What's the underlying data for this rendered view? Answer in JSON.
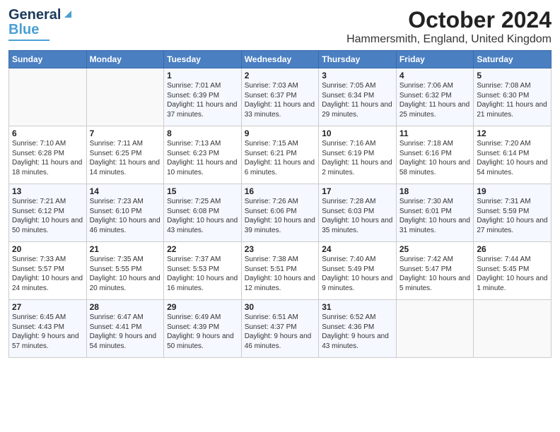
{
  "logo": {
    "line1": "General",
    "line2": "Blue"
  },
  "title": "October 2024",
  "subtitle": "Hammersmith, England, United Kingdom",
  "days_of_week": [
    "Sunday",
    "Monday",
    "Tuesday",
    "Wednesday",
    "Thursday",
    "Friday",
    "Saturday"
  ],
  "weeks": [
    [
      {
        "day": "",
        "sunrise": "",
        "sunset": "",
        "daylight": ""
      },
      {
        "day": "",
        "sunrise": "",
        "sunset": "",
        "daylight": ""
      },
      {
        "day": "1",
        "sunrise": "Sunrise: 7:01 AM",
        "sunset": "Sunset: 6:39 PM",
        "daylight": "Daylight: 11 hours and 37 minutes."
      },
      {
        "day": "2",
        "sunrise": "Sunrise: 7:03 AM",
        "sunset": "Sunset: 6:37 PM",
        "daylight": "Daylight: 11 hours and 33 minutes."
      },
      {
        "day": "3",
        "sunrise": "Sunrise: 7:05 AM",
        "sunset": "Sunset: 6:34 PM",
        "daylight": "Daylight: 11 hours and 29 minutes."
      },
      {
        "day": "4",
        "sunrise": "Sunrise: 7:06 AM",
        "sunset": "Sunset: 6:32 PM",
        "daylight": "Daylight: 11 hours and 25 minutes."
      },
      {
        "day": "5",
        "sunrise": "Sunrise: 7:08 AM",
        "sunset": "Sunset: 6:30 PM",
        "daylight": "Daylight: 11 hours and 21 minutes."
      }
    ],
    [
      {
        "day": "6",
        "sunrise": "Sunrise: 7:10 AM",
        "sunset": "Sunset: 6:28 PM",
        "daylight": "Daylight: 11 hours and 18 minutes."
      },
      {
        "day": "7",
        "sunrise": "Sunrise: 7:11 AM",
        "sunset": "Sunset: 6:25 PM",
        "daylight": "Daylight: 11 hours and 14 minutes."
      },
      {
        "day": "8",
        "sunrise": "Sunrise: 7:13 AM",
        "sunset": "Sunset: 6:23 PM",
        "daylight": "Daylight: 11 hours and 10 minutes."
      },
      {
        "day": "9",
        "sunrise": "Sunrise: 7:15 AM",
        "sunset": "Sunset: 6:21 PM",
        "daylight": "Daylight: 11 hours and 6 minutes."
      },
      {
        "day": "10",
        "sunrise": "Sunrise: 7:16 AM",
        "sunset": "Sunset: 6:19 PM",
        "daylight": "Daylight: 11 hours and 2 minutes."
      },
      {
        "day": "11",
        "sunrise": "Sunrise: 7:18 AM",
        "sunset": "Sunset: 6:16 PM",
        "daylight": "Daylight: 10 hours and 58 minutes."
      },
      {
        "day": "12",
        "sunrise": "Sunrise: 7:20 AM",
        "sunset": "Sunset: 6:14 PM",
        "daylight": "Daylight: 10 hours and 54 minutes."
      }
    ],
    [
      {
        "day": "13",
        "sunrise": "Sunrise: 7:21 AM",
        "sunset": "Sunset: 6:12 PM",
        "daylight": "Daylight: 10 hours and 50 minutes."
      },
      {
        "day": "14",
        "sunrise": "Sunrise: 7:23 AM",
        "sunset": "Sunset: 6:10 PM",
        "daylight": "Daylight: 10 hours and 46 minutes."
      },
      {
        "day": "15",
        "sunrise": "Sunrise: 7:25 AM",
        "sunset": "Sunset: 6:08 PM",
        "daylight": "Daylight: 10 hours and 43 minutes."
      },
      {
        "day": "16",
        "sunrise": "Sunrise: 7:26 AM",
        "sunset": "Sunset: 6:06 PM",
        "daylight": "Daylight: 10 hours and 39 minutes."
      },
      {
        "day": "17",
        "sunrise": "Sunrise: 7:28 AM",
        "sunset": "Sunset: 6:03 PM",
        "daylight": "Daylight: 10 hours and 35 minutes."
      },
      {
        "day": "18",
        "sunrise": "Sunrise: 7:30 AM",
        "sunset": "Sunset: 6:01 PM",
        "daylight": "Daylight: 10 hours and 31 minutes."
      },
      {
        "day": "19",
        "sunrise": "Sunrise: 7:31 AM",
        "sunset": "Sunset: 5:59 PM",
        "daylight": "Daylight: 10 hours and 27 minutes."
      }
    ],
    [
      {
        "day": "20",
        "sunrise": "Sunrise: 7:33 AM",
        "sunset": "Sunset: 5:57 PM",
        "daylight": "Daylight: 10 hours and 24 minutes."
      },
      {
        "day": "21",
        "sunrise": "Sunrise: 7:35 AM",
        "sunset": "Sunset: 5:55 PM",
        "daylight": "Daylight: 10 hours and 20 minutes."
      },
      {
        "day": "22",
        "sunrise": "Sunrise: 7:37 AM",
        "sunset": "Sunset: 5:53 PM",
        "daylight": "Daylight: 10 hours and 16 minutes."
      },
      {
        "day": "23",
        "sunrise": "Sunrise: 7:38 AM",
        "sunset": "Sunset: 5:51 PM",
        "daylight": "Daylight: 10 hours and 12 minutes."
      },
      {
        "day": "24",
        "sunrise": "Sunrise: 7:40 AM",
        "sunset": "Sunset: 5:49 PM",
        "daylight": "Daylight: 10 hours and 9 minutes."
      },
      {
        "day": "25",
        "sunrise": "Sunrise: 7:42 AM",
        "sunset": "Sunset: 5:47 PM",
        "daylight": "Daylight: 10 hours and 5 minutes."
      },
      {
        "day": "26",
        "sunrise": "Sunrise: 7:44 AM",
        "sunset": "Sunset: 5:45 PM",
        "daylight": "Daylight: 10 hours and 1 minute."
      }
    ],
    [
      {
        "day": "27",
        "sunrise": "Sunrise: 6:45 AM",
        "sunset": "Sunset: 4:43 PM",
        "daylight": "Daylight: 9 hours and 57 minutes."
      },
      {
        "day": "28",
        "sunrise": "Sunrise: 6:47 AM",
        "sunset": "Sunset: 4:41 PM",
        "daylight": "Daylight: 9 hours and 54 minutes."
      },
      {
        "day": "29",
        "sunrise": "Sunrise: 6:49 AM",
        "sunset": "Sunset: 4:39 PM",
        "daylight": "Daylight: 9 hours and 50 minutes."
      },
      {
        "day": "30",
        "sunrise": "Sunrise: 6:51 AM",
        "sunset": "Sunset: 4:37 PM",
        "daylight": "Daylight: 9 hours and 46 minutes."
      },
      {
        "day": "31",
        "sunrise": "Sunrise: 6:52 AM",
        "sunset": "Sunset: 4:36 PM",
        "daylight": "Daylight: 9 hours and 43 minutes."
      },
      {
        "day": "",
        "sunrise": "",
        "sunset": "",
        "daylight": ""
      },
      {
        "day": "",
        "sunrise": "",
        "sunset": "",
        "daylight": ""
      }
    ]
  ]
}
